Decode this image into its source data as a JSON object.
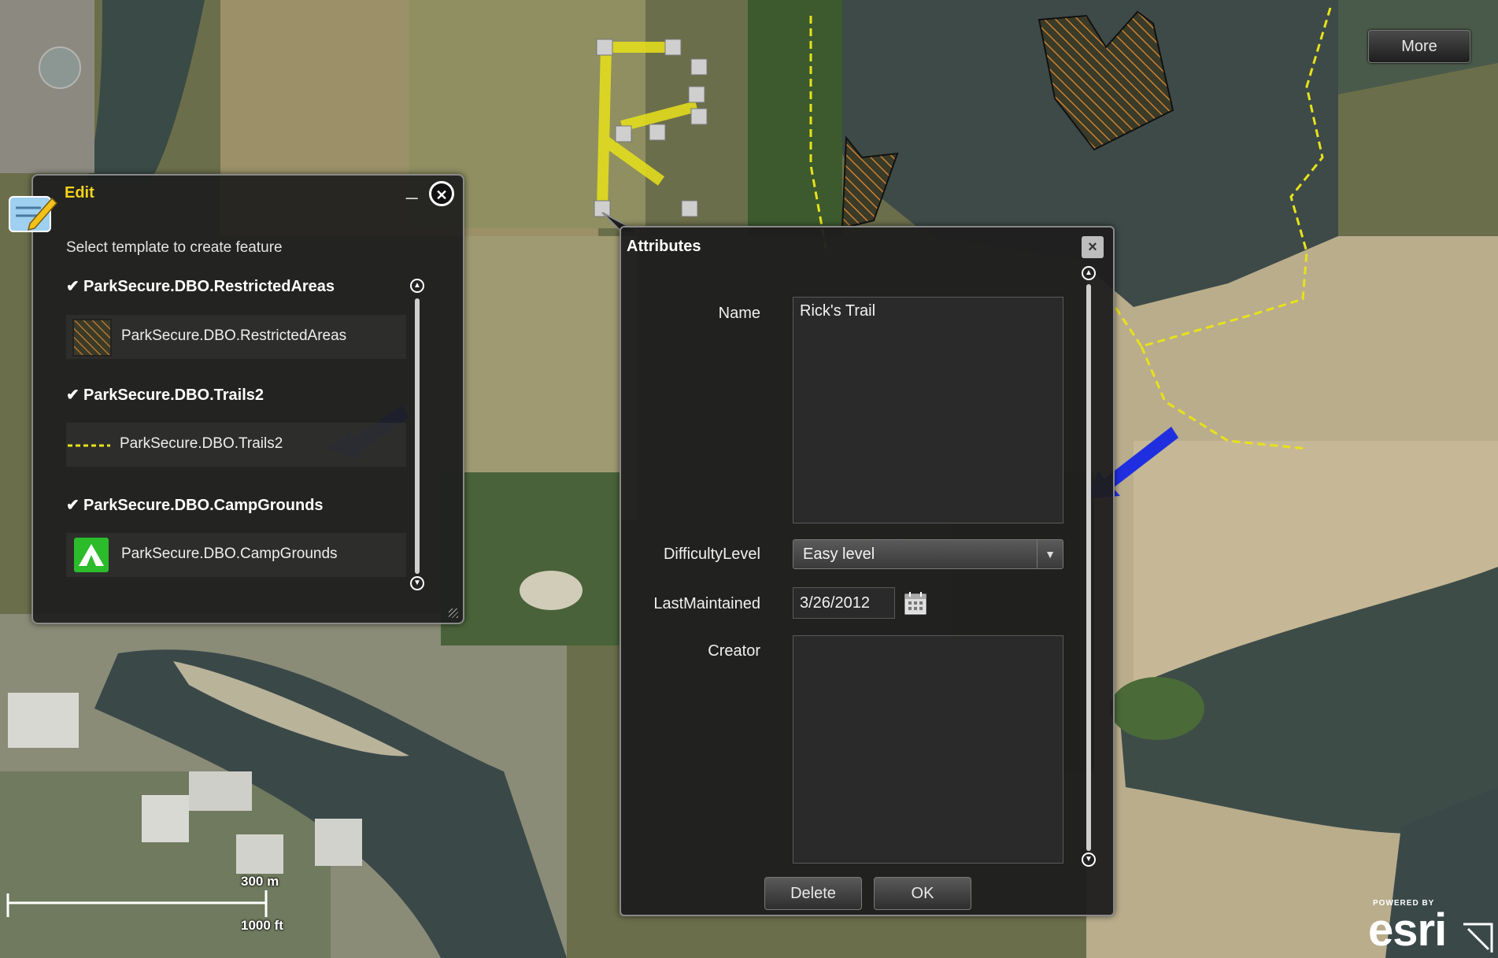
{
  "map": {
    "more_label": "More",
    "scale": {
      "metric_label": "300 m",
      "imperial_label": "1000 ft"
    },
    "attribution": {
      "powered_by": "POWERED BY",
      "brand": "esri"
    }
  },
  "edit_panel": {
    "title": "Edit",
    "minimize_glyph": "_",
    "close_glyph": "✕",
    "instruction": "Select template to create feature",
    "groups": [
      {
        "name": "ParkSecure.DBO.RestrictedAreas",
        "template": "ParkSecure.DBO.RestrictedAreas",
        "symbol": "hatched-polygon-icon"
      },
      {
        "name": "ParkSecure.DBO.Trails2",
        "template": "ParkSecure.DBO.Trails2",
        "symbol": "dashed-line-icon"
      },
      {
        "name": "ParkSecure.DBO.CampGrounds",
        "template": "ParkSecure.DBO.CampGrounds",
        "symbol": "campground-icon"
      }
    ]
  },
  "attributes_panel": {
    "title": "Attributes",
    "close_glyph": "×",
    "fields": {
      "name_label": "Name",
      "name_value": "Rick's Trail",
      "difficulty_label": "DifficultyLevel",
      "difficulty_value": "Easy level",
      "last_maintained_label": "LastMaintained",
      "last_maintained_value": "3/26/2012",
      "creator_label": "Creator",
      "creator_value": ""
    },
    "delete_label": "Delete",
    "ok_label": "OK"
  },
  "colors": {
    "panel_bg": "#1e1e1e",
    "edit_title": "#f2d21a",
    "trail_yellow": "#e8e21a",
    "arrow_blue": "#1f2fe0",
    "camp_green": "#2bbb2b"
  }
}
